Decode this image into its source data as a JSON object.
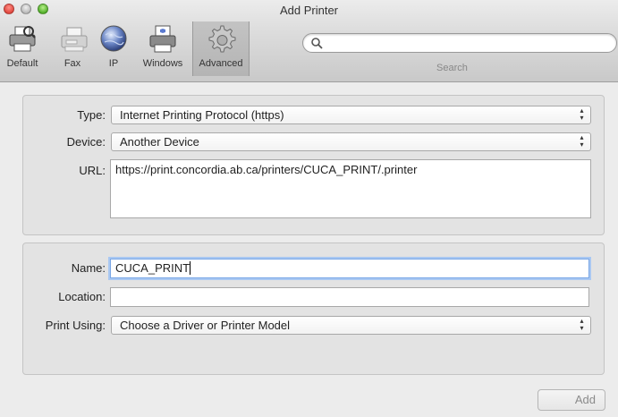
{
  "window": {
    "title": "Add Printer"
  },
  "toolbar": {
    "items": [
      {
        "label": "Default",
        "icon": "default-printer-icon"
      },
      {
        "label": "Fax",
        "icon": "fax-icon"
      },
      {
        "label": "IP",
        "icon": "ip-globe-icon"
      },
      {
        "label": "Windows",
        "icon": "windows-printer-icon"
      },
      {
        "label": "Advanced",
        "icon": "advanced-gear-icon",
        "selected": true
      }
    ],
    "search": {
      "label": "Search",
      "value": ""
    }
  },
  "device_section": {
    "type_label": "Type:",
    "type_value": "Internet Printing Protocol (https)",
    "device_label": "Device:",
    "device_value": "Another Device",
    "url_label": "URL:",
    "url_value": "https://print.concordia.ab.ca/printers/CUCA_PRINT/.printer"
  },
  "printer_section": {
    "name_label": "Name:",
    "name_value": "CUCA_PRINT",
    "location_label": "Location:",
    "location_value": "",
    "print_using_label": "Print Using:",
    "print_using_value": "Choose a Driver or Printer Model"
  },
  "footer": {
    "add_label": "Add"
  },
  "colors": {
    "focus_ring": "#a9c8f2",
    "close": "#e2483f",
    "zoom": "#54b02c"
  }
}
